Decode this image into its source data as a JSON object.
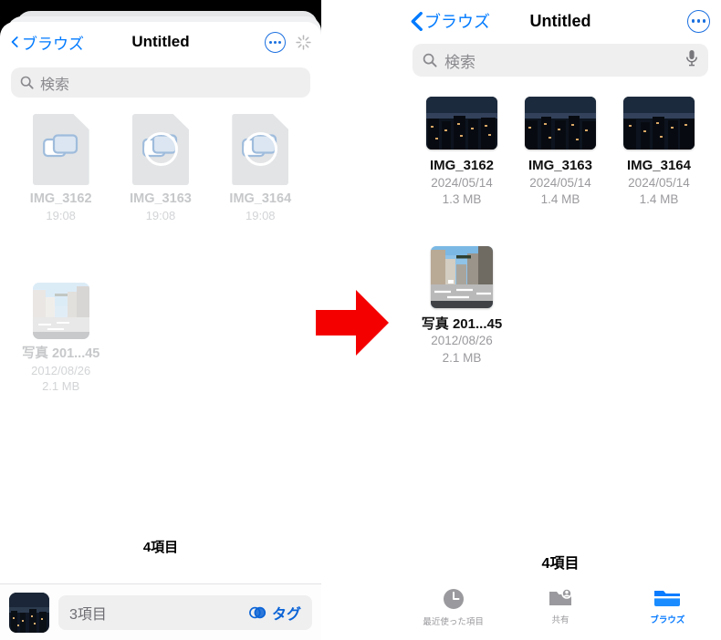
{
  "left_panel": {
    "nav": {
      "back_label": "ブラウズ",
      "title": "Untitled",
      "more_icon": "ellipsis-circle-icon",
      "spinner_icon": "activity-spinner-icon"
    },
    "search": {
      "placeholder": "検索",
      "icon": "search-icon"
    },
    "files": [
      {
        "name": "IMG_3162",
        "meta1": "19:08",
        "meta2": "",
        "icon": "document-copy-icon",
        "progress": false
      },
      {
        "name": "IMG_3163",
        "meta1": "19:08",
        "meta2": "",
        "icon": "document-copy-icon",
        "progress": true
      },
      {
        "name": "IMG_3164",
        "meta1": "19:08",
        "meta2": "",
        "icon": "document-copy-icon",
        "progress": true
      },
      {
        "name": "写真 201...45",
        "meta1": "2012/08/26",
        "meta2": "2.1 MB",
        "icon": "photo-thumbnail",
        "progress": false
      }
    ],
    "count_label": "4項目",
    "drag_tray": {
      "thumbnail": "night-city-thumbnail",
      "items_label": "3項目",
      "tag_label": "タグ",
      "tag_icon": "tag-circles-icon"
    }
  },
  "arrow": {
    "name": "red-right-arrow",
    "color": "#f40000"
  },
  "right_panel": {
    "nav": {
      "back_label": "ブラウズ",
      "title": "Untitled",
      "more_icon": "ellipsis-circle-icon"
    },
    "search": {
      "placeholder": "検索",
      "icon": "search-icon",
      "mic_icon": "microphone-icon"
    },
    "files": [
      {
        "name": "IMG_3162",
        "meta1": "2024/05/14",
        "meta2": "1.3 MB",
        "thumb": "night-city"
      },
      {
        "name": "IMG_3163",
        "meta1": "2024/05/14",
        "meta2": "1.4 MB",
        "thumb": "night-city"
      },
      {
        "name": "IMG_3164",
        "meta1": "2024/05/14",
        "meta2": "1.4 MB",
        "thumb": "night-city"
      },
      {
        "name": "写真 201...45",
        "meta1": "2012/08/26",
        "meta2": "2.1 MB",
        "thumb": "street-day"
      }
    ],
    "count_label": "4項目",
    "tabs": [
      {
        "label": "最近使った項目",
        "icon": "clock-icon",
        "active": false
      },
      {
        "label": "共有",
        "icon": "shared-folder-icon",
        "active": false
      },
      {
        "label": "ブラウズ",
        "icon": "folder-icon",
        "active": true
      }
    ]
  },
  "colors": {
    "accent": "#007aff",
    "accent_dark": "#1a6fe0",
    "arrow_red": "#f40000",
    "grey_text": "#9a9a9e"
  }
}
